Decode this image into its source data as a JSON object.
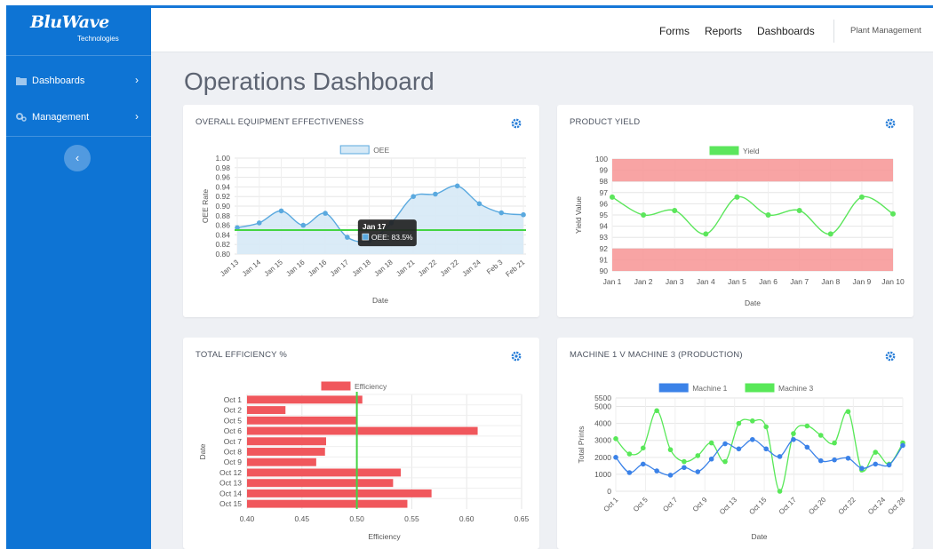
{
  "brand": {
    "name": "BluWave",
    "tagline": "Technologies"
  },
  "sidebar": {
    "items": [
      {
        "label": "Dashboards",
        "icon": "folder-icon"
      },
      {
        "label": "Management",
        "icon": "gears-icon"
      }
    ],
    "collapse_icon": "chevron-left-icon"
  },
  "topnav": {
    "links": [
      "Forms",
      "Reports",
      "Dashboards"
    ],
    "right_link": "Plant Management"
  },
  "page": {
    "title": "Operations Dashboard"
  },
  "colors": {
    "sidebar": "#0e74d4",
    "oee_line": "#5aa9df",
    "oee_fill": "#d6e9f6",
    "target": "#44d444",
    "yield_green": "#5ce65c",
    "yield_band": "#f79494",
    "bar_red": "#f0575c",
    "machine1": "#3b82e8",
    "machine3": "#58e858"
  },
  "cards": [
    {
      "title": "OVERALL EQUIPMENT EFFECTIVENESS",
      "icon": "gear-icon"
    },
    {
      "title": "PRODUCT YIELD",
      "icon": "gear-icon"
    },
    {
      "title": "TOTAL EFFICIENCY %",
      "icon": "gear-icon"
    },
    {
      "title": "MACHINE 1 V MACHINE 3 (PRODUCTION)",
      "icon": "gear-icon"
    }
  ],
  "chart_data": [
    {
      "type": "area",
      "title": "OVERALL EQUIPMENT EFFECTIVENESS",
      "xlabel": "Date",
      "ylabel": "OEE Rate",
      "categories": [
        "Jan 13",
        "Jan 14",
        "Jan 15",
        "Jan 16",
        "Jan 16",
        "Jan 17",
        "Jan 18",
        "Jan 18",
        "Jan 21",
        "Jan 22",
        "Jan 22",
        "Jan 24",
        "Feb 3",
        "Feb 21"
      ],
      "series": [
        {
          "name": "OEE",
          "values": [
            0.855,
            0.865,
            0.89,
            0.86,
            0.885,
            0.835,
            0.828,
            0.865,
            0.92,
            0.925,
            0.942,
            0.905,
            0.886,
            0.882
          ]
        }
      ],
      "target": 0.85,
      "ylim": [
        0.8,
        1.0
      ],
      "yticks": [
        "0.80",
        "0.82",
        "0.84",
        "0.86",
        "0.88",
        "0.90",
        "0.92",
        "0.94",
        "0.96",
        "0.98",
        "1.00"
      ],
      "tooltip": {
        "index": 5,
        "title": "Jan 17",
        "label": "OEE: 83.5%"
      },
      "legend": "top"
    },
    {
      "type": "line",
      "title": "PRODUCT YIELD",
      "xlabel": "Date",
      "ylabel": "Yield Value",
      "categories": [
        "Jan 1",
        "Jan 2",
        "Jan 3",
        "Jan 4",
        "Jan 5",
        "Jan 6",
        "Jan 7",
        "Jan 8",
        "Jan 9",
        "Jan 10"
      ],
      "series": [
        {
          "name": "Yield",
          "values": [
            96.6,
            95.0,
            95.4,
            93.3,
            96.6,
            95.0,
            95.4,
            93.3,
            96.6,
            95.1
          ]
        }
      ],
      "bands": [
        [
          98,
          100
        ],
        [
          90,
          92
        ]
      ],
      "ylim": [
        90,
        100
      ],
      "yticks": [
        "90",
        "91",
        "92",
        "93",
        "94",
        "95",
        "96",
        "97",
        "98",
        "99",
        "100"
      ],
      "legend": "top"
    },
    {
      "type": "bar",
      "orientation": "horizontal",
      "title": "TOTAL EFFICIENCY %",
      "xlabel": "Efficiency",
      "ylabel": "Date",
      "categories": [
        "Oct 1",
        "Oct 2",
        "Oct 5",
        "Oct 6",
        "Oct 7",
        "Oct 8",
        "Oct 9",
        "Oct 12",
        "Oct 13",
        "Oct 14",
        "Oct 15"
      ],
      "series": [
        {
          "name": "Efficiency",
          "values": [
            0.505,
            0.435,
            0.5,
            0.61,
            0.472,
            0.471,
            0.463,
            0.54,
            0.533,
            0.568,
            0.546
          ]
        }
      ],
      "target": 0.5,
      "xlim": [
        0.4,
        0.65
      ],
      "xticks": [
        "0.40",
        "0.45",
        "0.50",
        "0.55",
        "0.60",
        "0.65"
      ],
      "legend": "top"
    },
    {
      "type": "line",
      "title": "MACHINE 1 V MACHINE 3 (PRODUCTION)",
      "xlabel": "Date",
      "ylabel": "Total Prints",
      "x_count": 30,
      "xtick_labels": [
        "Oct 1",
        "Oct 5",
        "Oct 7",
        "Oct 9",
        "Oct 13",
        "Oct 15",
        "Oct 17",
        "Oct 20",
        "Oct 22",
        "Oct 24",
        "Oct 28"
      ],
      "xtick_positions": [
        0,
        3,
        6,
        9,
        12,
        15,
        18,
        21,
        24,
        27,
        29
      ],
      "series": [
        {
          "name": "Machine 1",
          "values": [
            2000,
            1100,
            1600,
            1200,
            950,
            1400,
            1150,
            1900,
            2800,
            2500,
            3050,
            2500,
            2050,
            3050,
            2600,
            1800,
            1850,
            1950,
            1350,
            1600,
            1550,
            2700
          ]
        },
        {
          "name": "Machine 3",
          "values": [
            3100,
            2200,
            2550,
            4750,
            2450,
            1750,
            2100,
            2850,
            1750,
            4000,
            4150,
            3800,
            0,
            3400,
            3850,
            3300,
            2850,
            4700,
            1250,
            2300,
            1600,
            2850
          ]
        }
      ],
      "ylim": [
        0,
        5500
      ],
      "yticks": [
        "0",
        "1000",
        "2000",
        "3000",
        "4000",
        "5000",
        "5500"
      ],
      "legend": "top"
    }
  ]
}
